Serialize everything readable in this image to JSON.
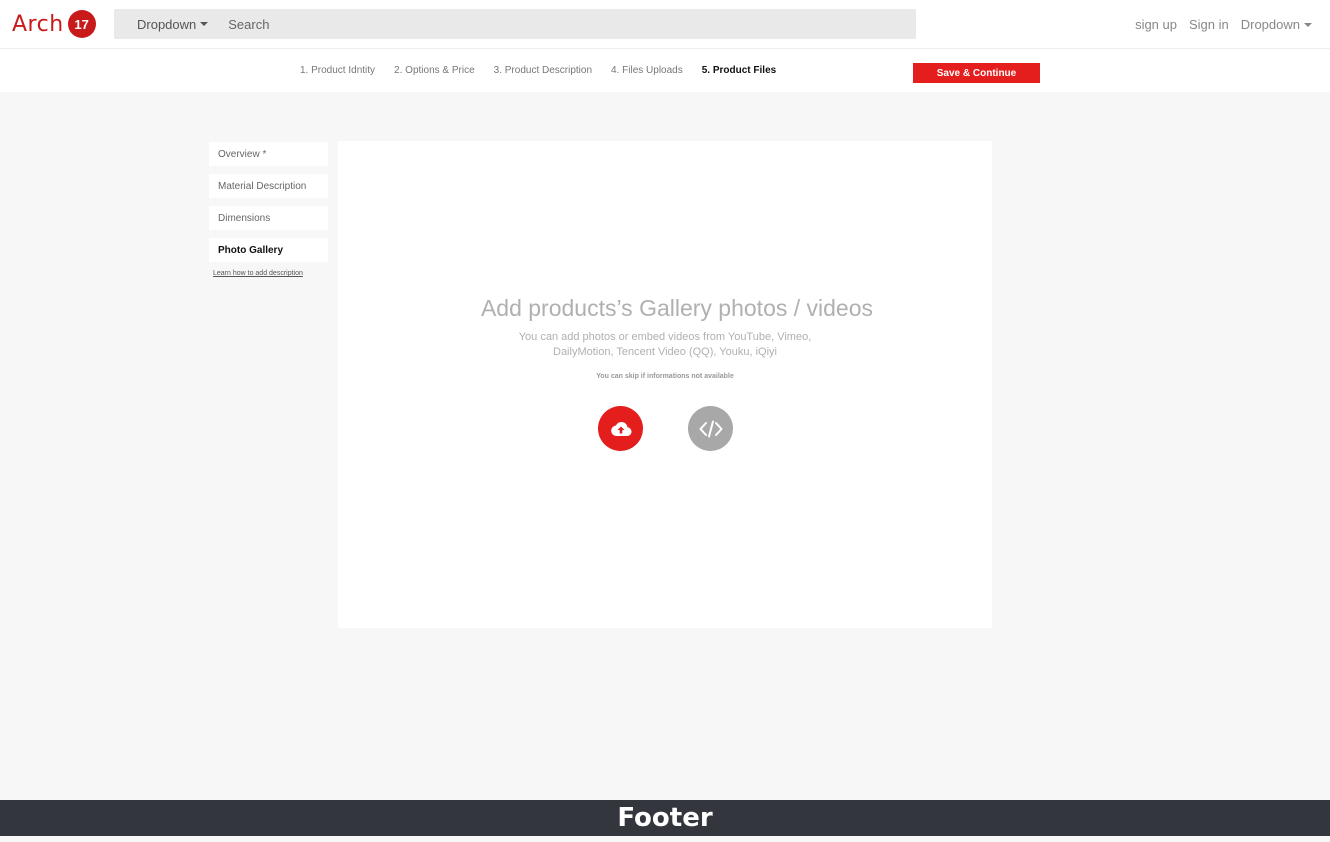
{
  "header": {
    "logo_text": "Arch",
    "logo_badge": "17",
    "dropdown_label": "Dropdown",
    "search_placeholder": "Search",
    "nav": {
      "signup": "sign up",
      "signin": "Sign in",
      "dropdown": "Dropdown"
    }
  },
  "steps": [
    {
      "label": "1. Product Idntity"
    },
    {
      "label": "2. Options & Price"
    },
    {
      "label": "3. Product Description"
    },
    {
      "label": "4. Files Uploads"
    },
    {
      "label": "5. Product Files",
      "active": true
    }
  ],
  "save_button": "Save & Continue",
  "sidebar": {
    "items": [
      {
        "label": "Overview *"
      },
      {
        "label": "Material Description"
      },
      {
        "label": "Dimensions"
      },
      {
        "label": "Photo Gallery",
        "active": true
      }
    ],
    "learn_link": "Learn how to add description"
  },
  "panel": {
    "title": "Add products’s Gallery photos / videos",
    "subtitle": "You can add photos or embed videos from YouTube, Vimeo, DailyMotion, Tencent Video (QQ), Youku, iQiyi",
    "skip_note": "You can skip if informations not available",
    "upload_icon": "cloud-upload-icon",
    "embed_icon": "code-embed-icon"
  },
  "footer": {
    "label": "Footer"
  },
  "colors": {
    "brand": "#c81a1a",
    "primary_button": "#e41d1d",
    "secondary_button": "#a8a8a8",
    "footer_bg": "#33363d"
  }
}
